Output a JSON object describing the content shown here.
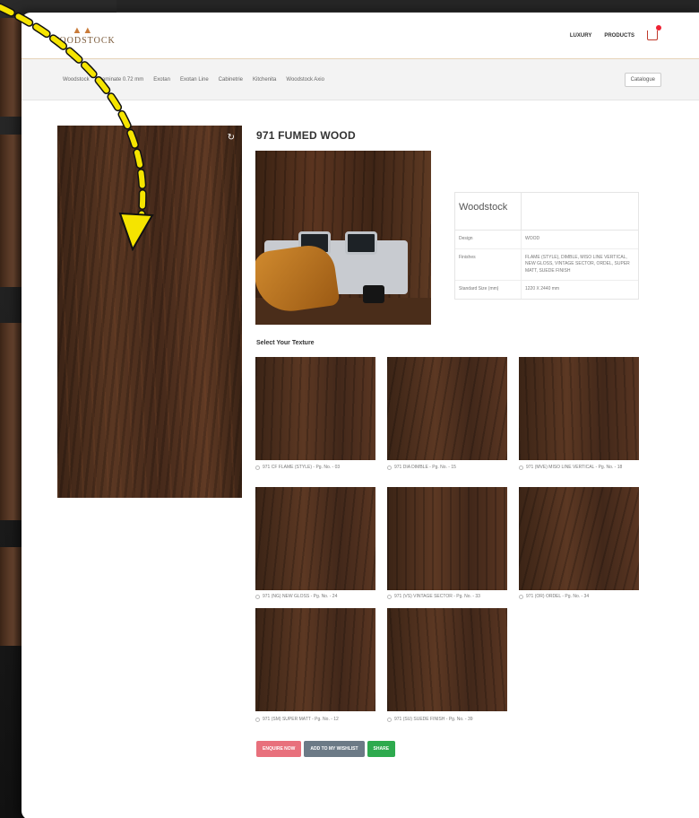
{
  "header": {
    "logo_text": "WOODSTOCK",
    "nav": [
      "LUXURY",
      "PRODUCTS"
    ]
  },
  "subnav": {
    "items": [
      "Woodstock",
      "Laminate 0.72 mm",
      "Exotan",
      "Exotan Line",
      "Cabinetrie",
      "Kitchenita",
      "Woodstock Axio"
    ],
    "catalogue_label": "Catalogue"
  },
  "product": {
    "title": "971 FUMED WOOD",
    "brand": "Woodstock",
    "specs": [
      {
        "key": "Design",
        "value": "WOOD"
      },
      {
        "key": "Finishes",
        "value": "FLAME (STYLE), DIMBLE, MISO LINE VERTICAL, NEW GLOSS, VINTAGE SECTOR, ORDEL, SUPER MATT, SUEDE FINISH"
      },
      {
        "key": "Standard Size (mm)",
        "value": "1220 X 2440 mm"
      }
    ]
  },
  "textures": {
    "heading": "Select Your Texture",
    "items": [
      {
        "label": "971 CF FLAME (STYLE) - Pg. No. - 03"
      },
      {
        "label": "971 DIA DIMBLE - Pg. No. - 15"
      },
      {
        "label": "971 (MVE) MISO LINE VERTICAL - Pg. No. - 18"
      },
      {
        "label": "971 (NG) NEW GLOSS - Pg. No. - 24"
      },
      {
        "label": "971 (VS) VINTAGE SECTOR - Pg. No. - 33"
      },
      {
        "label": "971 (OR) ORDEL - Pg. No. - 34"
      },
      {
        "label": "971 (SM) SUPER MATT - Pg. No. - 12"
      },
      {
        "label": "971 (SU) SUEDE FINISH - Pg. No. - 39"
      }
    ]
  },
  "actions": {
    "enquire": "ENQUIRE NOW",
    "wishlist": "ADD TO MY WISHLIST",
    "share": "SHARE"
  },
  "colors": {
    "enquire": "#e8707c",
    "wishlist": "#6c7a86",
    "share": "#2eaa4e",
    "annotation_arrow": "#f5e400"
  }
}
